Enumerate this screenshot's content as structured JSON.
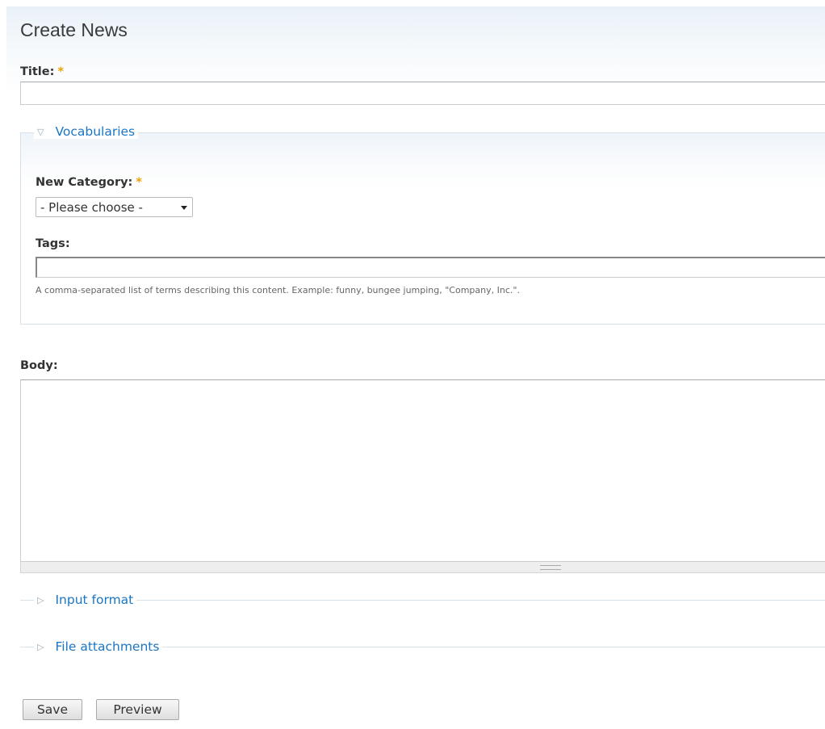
{
  "page": {
    "title": "Create News"
  },
  "title_field": {
    "label": "Title:",
    "required_marker": "*",
    "value": ""
  },
  "vocabularies": {
    "legend": "Vocabularies",
    "new_category": {
      "label": "New Category:",
      "required_marker": "*",
      "selected": "- Please choose -"
    },
    "tags": {
      "label": "Tags:",
      "value": "",
      "description": "A comma-separated list of terms describing this content. Example: funny, bungee jumping, \"Company, Inc.\"."
    }
  },
  "body_field": {
    "label": "Body:",
    "value": ""
  },
  "input_format": {
    "legend": "Input format"
  },
  "file_attachments": {
    "legend": "File attachments"
  },
  "actions": {
    "save": "Save",
    "preview": "Preview"
  },
  "colors": {
    "link": "#1a76c3",
    "required": "#f0a100",
    "fieldset_border": "#d8e1ea"
  }
}
